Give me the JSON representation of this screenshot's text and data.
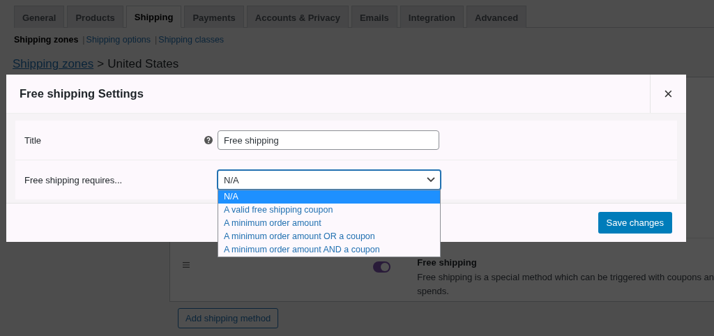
{
  "tabs": [
    {
      "label": "General",
      "selected": false
    },
    {
      "label": "Products",
      "selected": false
    },
    {
      "label": "Shipping",
      "selected": true
    },
    {
      "label": "Payments",
      "selected": false
    },
    {
      "label": "Accounts & Privacy",
      "selected": false
    },
    {
      "label": "Emails",
      "selected": false
    },
    {
      "label": "Integration",
      "selected": false
    },
    {
      "label": "Advanced",
      "selected": false
    }
  ],
  "subnav": [
    {
      "label": "Shipping zones",
      "selected": true
    },
    {
      "label": "Shipping options",
      "selected": false
    },
    {
      "label": "Shipping classes",
      "selected": false
    }
  ],
  "subnav_separator": "|",
  "breadcrumb": {
    "link": "Shipping zones",
    "separator": ">",
    "current": "United States"
  },
  "method_row": {
    "enabled": true,
    "title": "Free shipping",
    "description": [
      "Free shipping is a special method which can be triggered with coupons an",
      "spends."
    ]
  },
  "add_button": "Add shipping method",
  "modal": {
    "title": "Free shipping Settings",
    "close": "×",
    "fields": [
      {
        "kind": "text",
        "label": "Title",
        "help": true,
        "value": "Free shipping"
      },
      {
        "kind": "select",
        "label": "Free shipping requires...",
        "value": "N/A",
        "expanded": true,
        "options": [
          {
            "label": "N/A",
            "selected": true
          },
          {
            "label": "A valid free shipping coupon",
            "selected": false
          },
          {
            "label": "A minimum order amount",
            "selected": false
          },
          {
            "label": "A minimum order amount OR a coupon",
            "selected": false
          },
          {
            "label": "A minimum order amount AND a coupon",
            "selected": false
          }
        ]
      }
    ],
    "save": "Save changes"
  }
}
